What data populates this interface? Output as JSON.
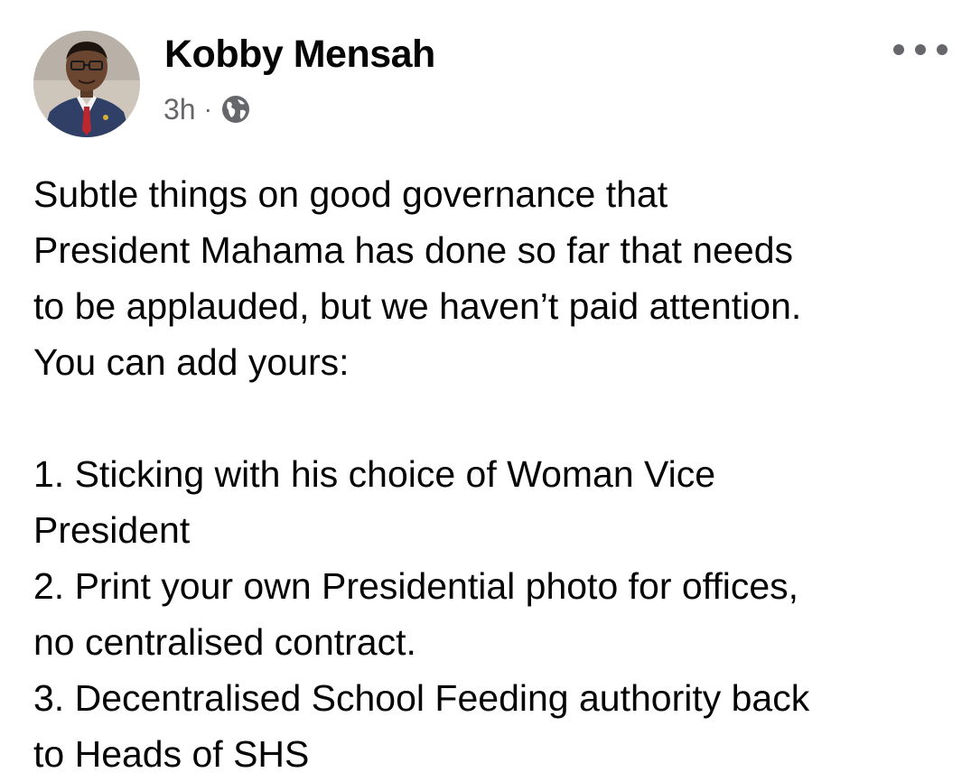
{
  "post": {
    "author": "Kobby Mensah",
    "timestamp": "3h",
    "separator": "·",
    "privacy_icon": "globe-icon",
    "more_icon": "more-options-icon",
    "intro_lines": [
      "Subtle things on good governance that",
      "President Mahama has done so far that needs",
      "to be applauded, but we haven’t paid attention.",
      "You can add yours:"
    ],
    "list_lines": [
      "1. Sticking with his choice of Woman Vice",
      "President",
      "2. Print your own Presidential photo for offices,",
      "no centralised contract.",
      "3. Decentralised School Feeding authority back",
      "to Heads of SHS"
    ]
  },
  "colors": {
    "text": "#050505",
    "secondary_text": "#65676b"
  }
}
